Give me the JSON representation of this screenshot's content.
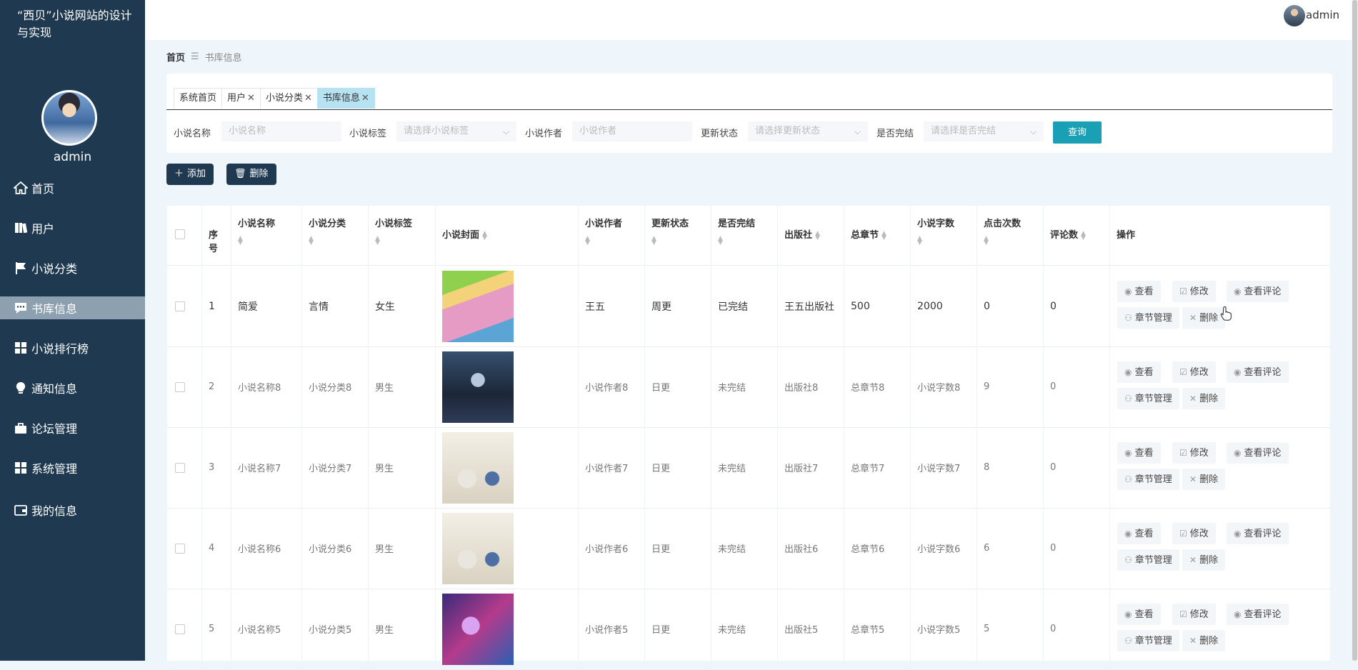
{
  "site": {
    "title": "“西贝”小说网站的设计与实现",
    "admin_name": "admin"
  },
  "sidebar": {
    "items": [
      {
        "label": "首页",
        "icon": "home-icon"
      },
      {
        "label": "用户",
        "icon": "book-icon"
      },
      {
        "label": "小说分类",
        "icon": "flag-icon"
      },
      {
        "label": "书库信息",
        "icon": "chat-icon"
      },
      {
        "label": "小说排行榜",
        "icon": "grid-icon"
      },
      {
        "label": "通知信息",
        "icon": "bulb-icon"
      },
      {
        "label": "论坛管理",
        "icon": "briefcase-icon"
      },
      {
        "label": "系统管理",
        "icon": "grid-icon"
      },
      {
        "label": "我的信息",
        "icon": "wallet-icon"
      }
    ],
    "active_index": 3
  },
  "topbar": {
    "user": "admin"
  },
  "breadcrumb": {
    "home": "首页",
    "current": "书库信息"
  },
  "tabs": [
    {
      "label": "系统首页",
      "closable": false
    },
    {
      "label": "用户",
      "closable": true
    },
    {
      "label": "小说分类",
      "closable": true
    },
    {
      "label": "书库信息",
      "closable": true,
      "active": true
    }
  ],
  "search": {
    "name_label": "小说名称",
    "name_placeholder": "小说名称",
    "tag_label": "小说标签",
    "tag_placeholder": "请选择小说标签",
    "author_label": "小说作者",
    "author_placeholder": "小说作者",
    "update_label": "更新状态",
    "update_placeholder": "请选择更新状态",
    "finished_label": "是否完结",
    "finished_placeholder": "请选择是否完结",
    "query_button": "查询"
  },
  "actions": {
    "add": "添加",
    "delete": "删除"
  },
  "table": {
    "headers": [
      "序号",
      "小说名称",
      "小说分类",
      "小说标签",
      "小说封面",
      "小说作者",
      "更新状态",
      "是否完结",
      "出版社",
      "总章节",
      "小说字数",
      "点击次数",
      "评论数",
      "操作"
    ],
    "rows": [
      {
        "no": "1",
        "name": "简爱",
        "category": "言情",
        "tag": "女生",
        "author": "王五",
        "update": "周更",
        "finished": "已完结",
        "publisher": "王五出版社",
        "chapters": "500",
        "words": "2000",
        "clicks": "0",
        "comments": "0",
        "cover": "cover-girl-garden"
      },
      {
        "no": "2",
        "name": "小说名称8",
        "category": "小说分类8",
        "tag": "男生",
        "author": "小说作者8",
        "update": "日更",
        "finished": "未完结",
        "publisher": "出版社8",
        "chapters": "总章节8",
        "words": "小说字数8",
        "clicks": "9",
        "comments": "0",
        "cover": "cover-warrior"
      },
      {
        "no": "3",
        "name": "小说名称7",
        "category": "小说分类7",
        "tag": "男生",
        "author": "小说作者7",
        "update": "日更",
        "finished": "未完结",
        "publisher": "出版社7",
        "chapters": "总章节7",
        "words": "小说字数7",
        "clicks": "8",
        "comments": "0",
        "cover": "cover-couple"
      },
      {
        "no": "4",
        "name": "小说名称6",
        "category": "小说分类6",
        "tag": "男生",
        "author": "小说作者6",
        "update": "日更",
        "finished": "未完结",
        "publisher": "出版社6",
        "chapters": "总章节6",
        "words": "小说字数6",
        "clicks": "6",
        "comments": "0",
        "cover": "cover-couple"
      },
      {
        "no": "5",
        "name": "小说名称5",
        "category": "小说分类5",
        "tag": "男生",
        "author": "小说作者5",
        "update": "日更",
        "finished": "未完结",
        "publisher": "出版社5",
        "chapters": "总章节5",
        "words": "小说字数5",
        "clicks": "5",
        "comments": "0",
        "cover": "cover-fantasy"
      }
    ],
    "ops": {
      "view": "查看",
      "edit": "修改",
      "view_comments": "查看评论",
      "chapters": "章节管理",
      "delete": "删除"
    }
  }
}
